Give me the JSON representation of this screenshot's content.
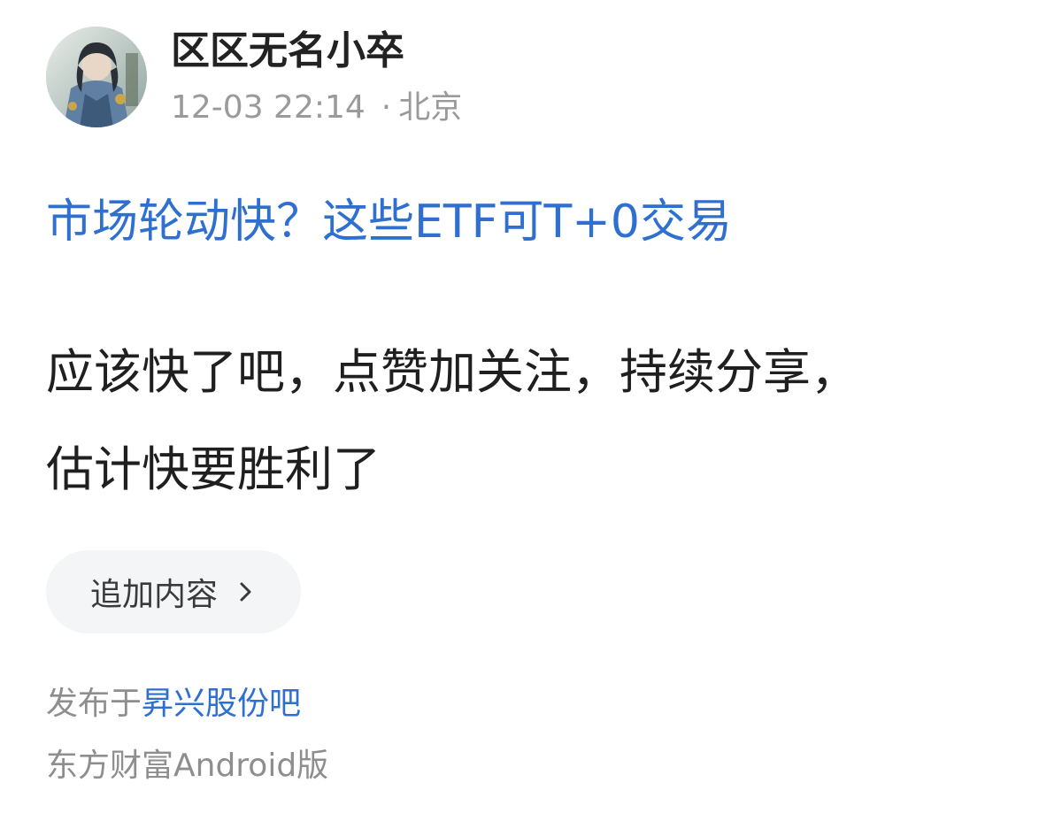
{
  "author": {
    "name": "区区无名小卒",
    "avatar_icon": "user-avatar"
  },
  "meta": {
    "time": "12-03 22:14",
    "separator": "·",
    "location": "北京"
  },
  "linked_title": "市场轮动快？这些ETF可T+0交易",
  "content": {
    "line1": "应该快了吧，点赞加关注，持续分享，",
    "line2": "估计快要胜利了"
  },
  "append_button": {
    "label": "追加内容",
    "icon": "chevron-right-icon"
  },
  "publish": {
    "prefix": "发布于",
    "forum": "昇兴股份吧"
  },
  "client": "东方财富Android版",
  "colors": {
    "link": "#2e6fd0",
    "muted": "#9a9a9a",
    "button_bg": "#f4f5f7"
  }
}
